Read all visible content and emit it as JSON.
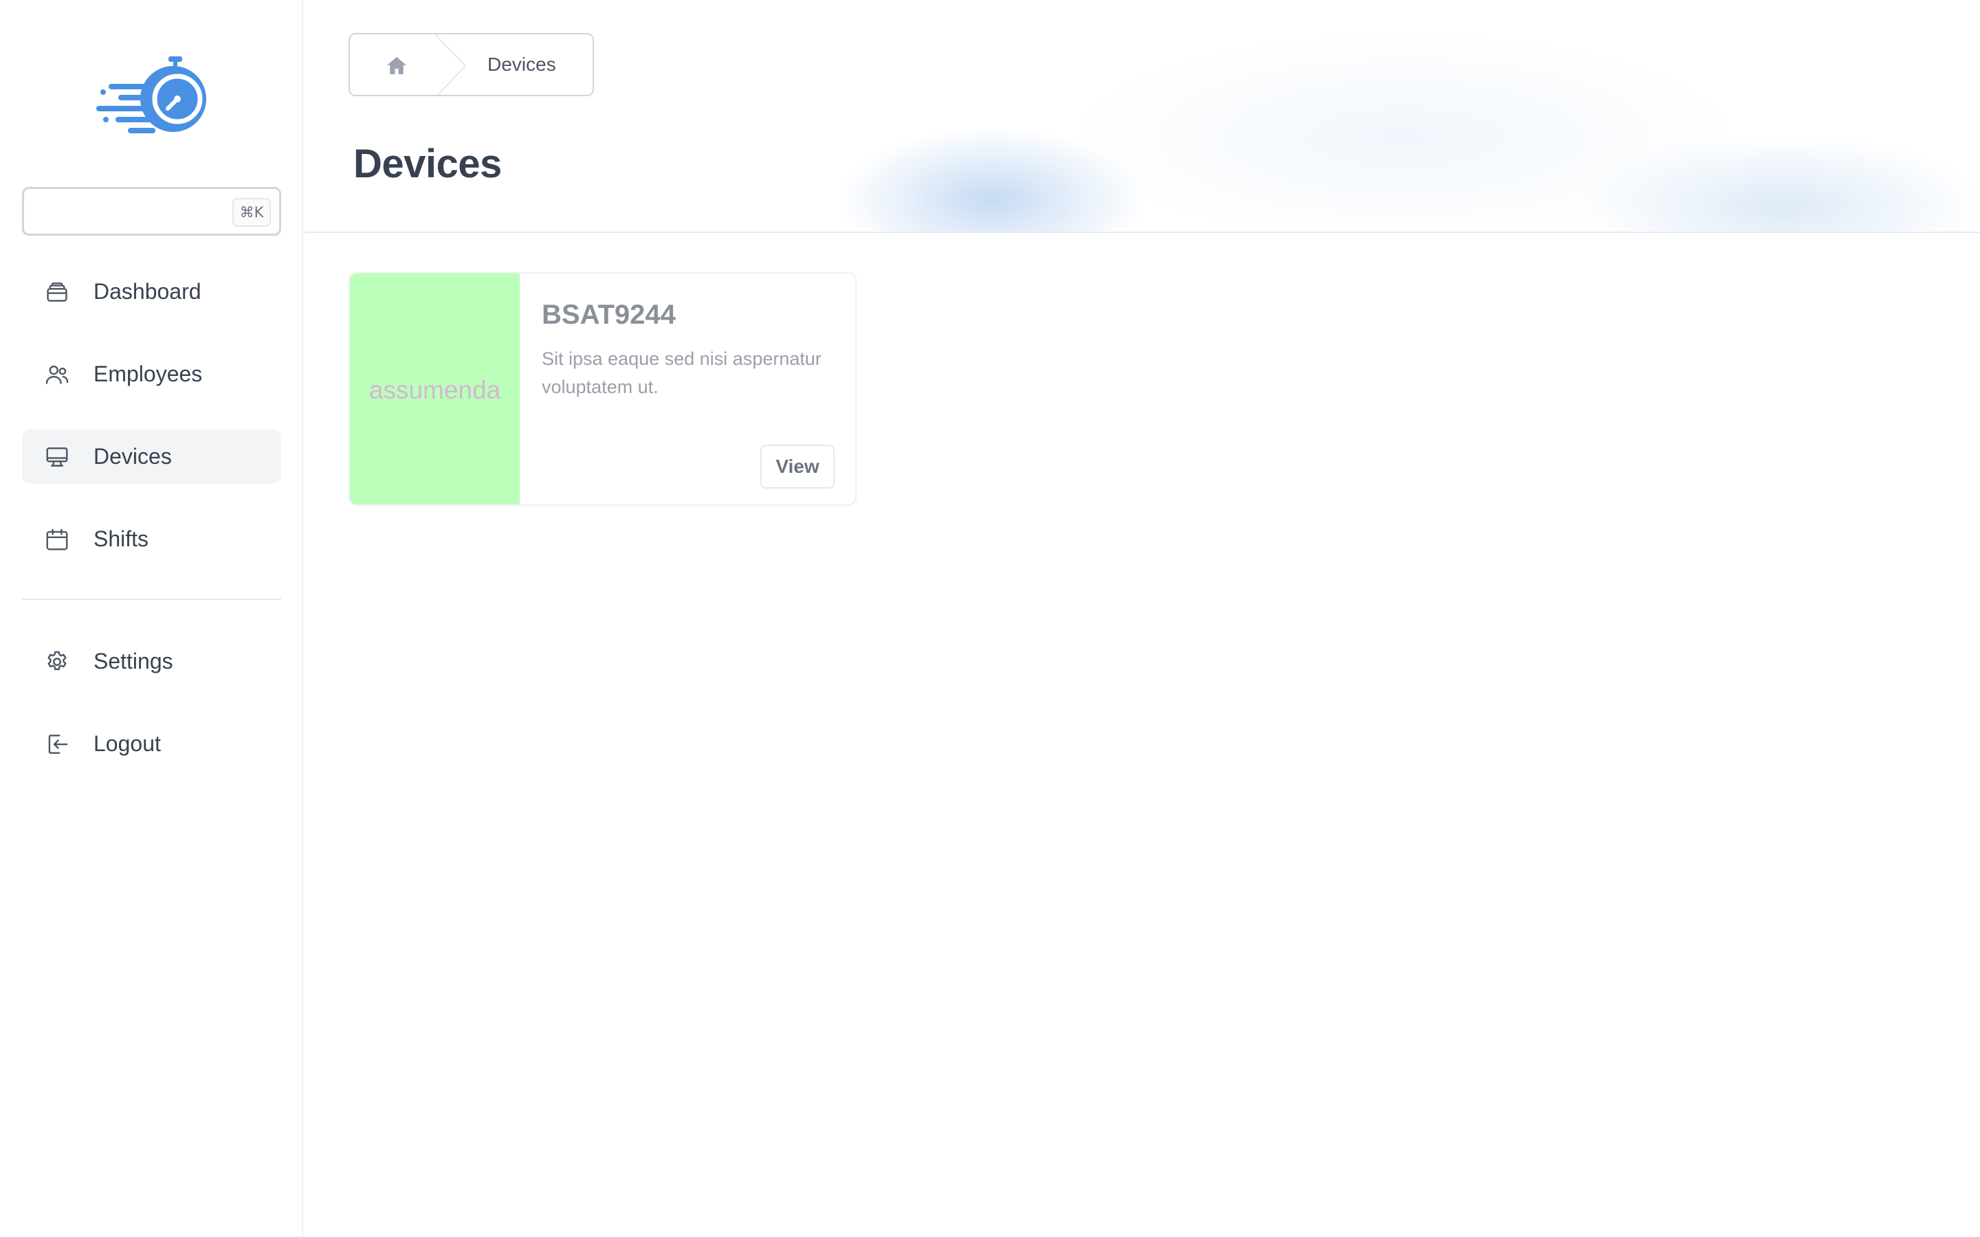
{
  "sidebar": {
    "search": {
      "placeholder": "",
      "shortcut": "⌘K"
    },
    "items": [
      {
        "label": "Dashboard",
        "icon": "inbox-stack-icon"
      },
      {
        "label": "Employees",
        "icon": "users-icon"
      },
      {
        "label": "Devices",
        "icon": "monitor-icon",
        "active": true
      },
      {
        "label": "Shifts",
        "icon": "calendar-icon"
      }
    ],
    "footer_items": [
      {
        "label": "Settings",
        "icon": "gear-icon"
      },
      {
        "label": "Logout",
        "icon": "logout-icon"
      }
    ]
  },
  "breadcrumb": {
    "current": "Devices"
  },
  "page": {
    "title": "Devices"
  },
  "cards": [
    {
      "media_text": "assumenda",
      "media_color": "#bbffbb",
      "title": "BSAT9244",
      "description": "Sit ipsa eaque sed nisi aspernatur voluptatem ut.",
      "button_label": "View"
    }
  ],
  "colors": {
    "brand": "#4a90e2",
    "active_bg": "#f3f4f6"
  }
}
